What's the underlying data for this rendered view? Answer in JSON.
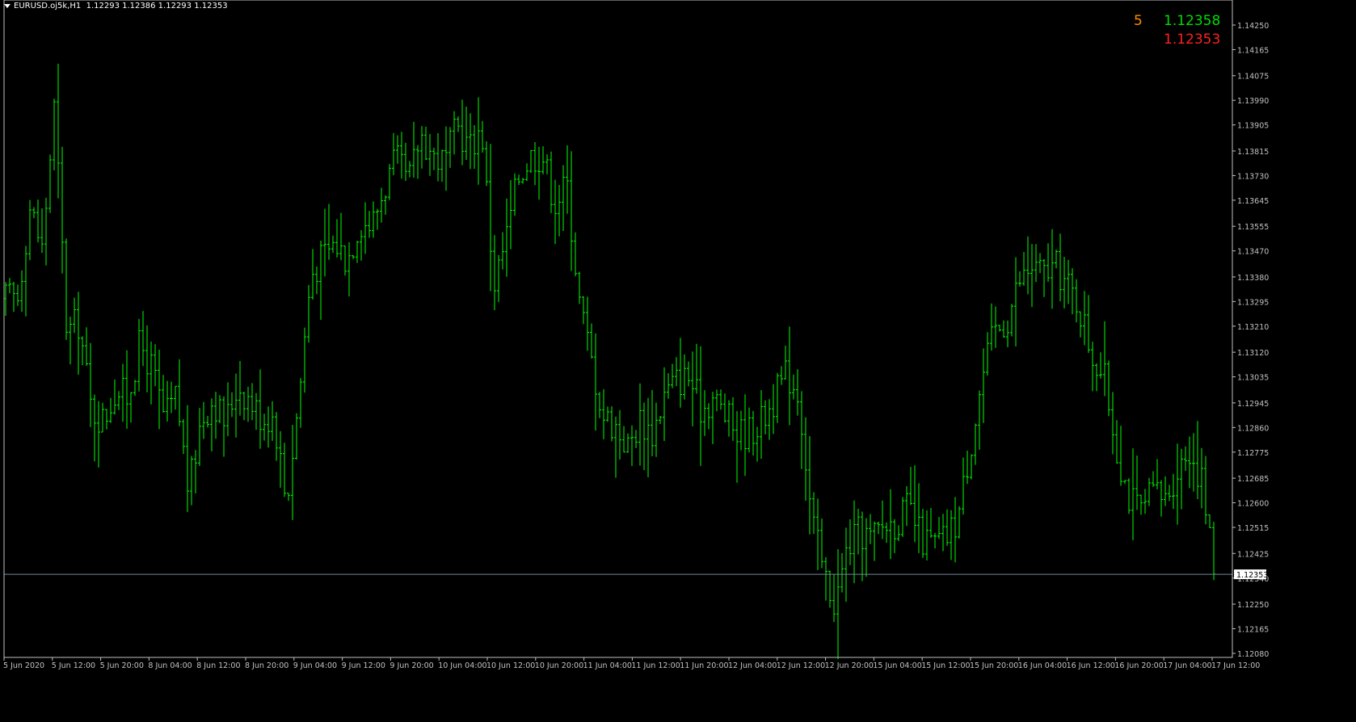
{
  "header": {
    "symbol": "EURUSD.oj5k,H1",
    "ohlc": "1.12293 1.12386 1.12293 1.12353"
  },
  "tick_info": {
    "spread": "5",
    "ask": "1.12358",
    "bid": "1.12353"
  },
  "colors": {
    "background": "#000000",
    "bar": "#00ff00",
    "axis": "#c0c0c0",
    "bid_line": "#778899",
    "spread": "#ff8c00",
    "ask": "#00dd00",
    "bid": "#ff0000"
  },
  "chart_data": {
    "type": "ohlc",
    "symbol": "EURUSD.oj5k",
    "timeframe": "H1",
    "y_ticks": [
      "1.14250",
      "1.14165",
      "1.14075",
      "1.13990",
      "1.13905",
      "1.13815",
      "1.13730",
      "1.13645",
      "1.13555",
      "1.13470",
      "1.13380",
      "1.13295",
      "1.13210",
      "1.13120",
      "1.13035",
      "1.12945",
      "1.12860",
      "1.12775",
      "1.12685",
      "1.12600",
      "1.12515",
      "1.12425",
      "1.12340",
      "1.12250",
      "1.12165",
      "1.12080"
    ],
    "ylim": [
      1.1208,
      1.1425
    ],
    "current_price": "1.12353",
    "x_ticks": [
      "5 Jun 2020",
      "5 Jun 12:00",
      "5 Jun 20:00",
      "8 Jun 04:00",
      "8 Jun 12:00",
      "8 Jun 20:00",
      "9 Jun 04:00",
      "9 Jun 12:00",
      "9 Jun 20:00",
      "10 Jun 04:00",
      "10 Jun 12:00",
      "10 Jun 20:00",
      "11 Jun 04:00",
      "11 Jun 12:00",
      "11 Jun 20:00",
      "12 Jun 04:00",
      "12 Jun 12:00",
      "12 Jun 20:00",
      "15 Jun 04:00",
      "15 Jun 12:00",
      "15 Jun 20:00",
      "16 Jun 04:00",
      "16 Jun 12:00",
      "16 Jun 20:00",
      "17 Jun 04:00",
      "17 Jun 12:00"
    ],
    "anchors": [
      [
        1.133,
        1.1331
      ],
      [
        1.1328,
        1.1334
      ],
      [
        1.1365,
        1.136
      ],
      [
        1.135,
        1.1345
      ],
      [
        1.14,
        1.1395
      ],
      [
        1.132,
        1.1318
      ],
      [
        1.132,
        1.1325
      ],
      [
        1.129,
        1.1295
      ],
      [
        1.1285,
        1.1292
      ],
      [
        1.13,
        1.1298
      ],
      [
        1.1295,
        1.1298
      ],
      [
        1.132,
        1.131
      ],
      [
        1.1312,
        1.13
      ],
      [
        1.129,
        1.1288
      ],
      [
        1.1296,
        1.1298
      ],
      [
        1.1262,
        1.1265
      ],
      [
        1.1285,
        1.1292
      ],
      [
        1.13,
        1.1292
      ],
      [
        1.129,
        1.1285
      ],
      [
        1.13,
        1.1302
      ],
      [
        1.1298,
        1.1293
      ],
      [
        1.1293,
        1.1286
      ],
      [
        1.1295,
        1.1285
      ],
      [
        1.125,
        1.127
      ],
      [
        1.129,
        1.13
      ],
      [
        1.1338,
        1.134
      ],
      [
        1.134,
        1.135
      ],
      [
        1.1355,
        1.1345
      ],
      [
        1.1345,
        1.1343
      ],
      [
        1.1355,
        1.136
      ],
      [
        1.135,
        1.1362
      ],
      [
        1.1362,
        1.1375
      ],
      [
        1.1372,
        1.1385
      ],
      [
        1.1375,
        1.1365
      ],
      [
        1.1395,
        1.138
      ],
      [
        1.1385,
        1.1375
      ],
      [
        1.1375,
        1.138
      ],
      [
        1.139,
        1.139
      ],
      [
        1.1385,
        1.138
      ],
      [
        1.1395,
        1.1385
      ],
      [
        1.133,
        1.134
      ],
      [
        1.1342,
        1.136
      ],
      [
        1.1365,
        1.138
      ],
      [
        1.139,
        1.137
      ],
      [
        1.138,
        1.138
      ],
      [
        1.1358,
        1.137
      ],
      [
        1.138,
        1.136
      ],
      [
        1.134,
        1.132
      ],
      [
        1.1308,
        1.131
      ],
      [
        1.1292,
        1.1288
      ],
      [
        1.1288,
        1.1285
      ],
      [
        1.128,
        1.1278
      ],
      [
        1.129,
        1.1288
      ],
      [
        1.1285,
        1.1283
      ],
      [
        1.1295,
        1.13
      ],
      [
        1.1305,
        1.13
      ],
      [
        1.1305,
        1.1302
      ],
      [
        1.13,
        1.1285
      ],
      [
        1.1298,
        1.1295
      ],
      [
        1.1285,
        1.1295
      ],
      [
        1.128,
        1.1288
      ],
      [
        1.128,
        1.129
      ],
      [
        1.1285,
        1.1292
      ],
      [
        1.129,
        1.1302
      ],
      [
        1.13,
        1.131
      ],
      [
        1.13,
        1.1296
      ],
      [
        1.1255,
        1.1258
      ],
      [
        1.124,
        1.1232
      ],
      [
        1.123,
        1.122
      ],
      [
        1.124,
        1.125
      ],
      [
        1.1245,
        1.1255
      ],
      [
        1.125,
        1.1245
      ],
      [
        1.125,
        1.1255
      ],
      [
        1.125,
        1.1257
      ],
      [
        1.1255,
        1.1262
      ],
      [
        1.125,
        1.1245
      ],
      [
        1.1248,
        1.1243
      ],
      [
        1.1245,
        1.125
      ],
      [
        1.1248,
        1.126
      ],
      [
        1.1275,
        1.1282
      ],
      [
        1.1295,
        1.131
      ],
      [
        1.132,
        1.1318
      ],
      [
        1.132,
        1.1325
      ],
      [
        1.1332,
        1.134
      ],
      [
        1.1345,
        1.1338
      ],
      [
        1.134,
        1.1338
      ],
      [
        1.1338,
        1.1345
      ],
      [
        1.134,
        1.133
      ],
      [
        1.1335,
        1.132
      ],
      [
        1.1318,
        1.1305
      ],
      [
        1.1305,
        1.1302
      ],
      [
        1.1278,
        1.1282
      ],
      [
        1.1255,
        1.127
      ],
      [
        1.1258,
        1.1255
      ],
      [
        1.1262,
        1.1265
      ],
      [
        1.1262,
        1.126
      ],
      [
        1.1268,
        1.1275
      ],
      [
        1.1268,
        1.129
      ],
      [
        1.1275,
        1.126
      ],
      [
        1.124,
        1.1235
      ]
    ],
    "volatility_seed": 17
  }
}
